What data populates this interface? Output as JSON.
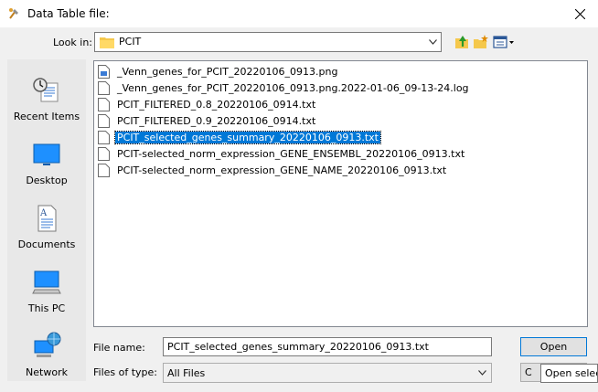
{
  "window": {
    "title": "Data Table file:"
  },
  "toolbar": {
    "look_in_label": "Look in:",
    "look_in_value": "PCIT"
  },
  "places": [
    {
      "label": "Recent Items",
      "icon": "recent-items-icon"
    },
    {
      "label": "Desktop",
      "icon": "desktop-icon"
    },
    {
      "label": "Documents",
      "icon": "documents-icon"
    },
    {
      "label": "This PC",
      "icon": "this-pc-icon"
    },
    {
      "label": "Network",
      "icon": "network-icon"
    }
  ],
  "files": [
    {
      "name": "_Venn_genes_for_PCIT_20220106_0913.png",
      "icon": "image-file-icon",
      "selected": false
    },
    {
      "name": "_Venn_genes_for_PCIT_20220106_0913.png.2022-01-06_09-13-24.log",
      "icon": "file-icon",
      "selected": false
    },
    {
      "name": "PCIT_FILTERED_0.8_20220106_0914.txt",
      "icon": "file-icon",
      "selected": false
    },
    {
      "name": "PCIT_FILTERED_0.9_20220106_0914.txt",
      "icon": "file-icon",
      "selected": false
    },
    {
      "name": "PCIT_selected_genes_summary_20220106_0913.txt",
      "icon": "file-icon",
      "selected": true
    },
    {
      "name": "PCIT-selected_norm_expression_GENE_ENSEMBL_20220106_0913.txt",
      "icon": "file-icon",
      "selected": false
    },
    {
      "name": "PCIT-selected_norm_expression_GENE_NAME_20220106_0913.txt",
      "icon": "file-icon",
      "selected": false
    }
  ],
  "bottom": {
    "file_name_label": "File name:",
    "file_name_value": "PCIT_selected_genes_summary_20220106_0913.txt",
    "files_of_type_label": "Files of type:",
    "files_of_type_value": "All Files",
    "open_label": "Open",
    "cancel_label": "C",
    "tooltip": "Open selec"
  },
  "colors": {
    "selection": "#0078d7",
    "background": "#f0f0f0"
  }
}
